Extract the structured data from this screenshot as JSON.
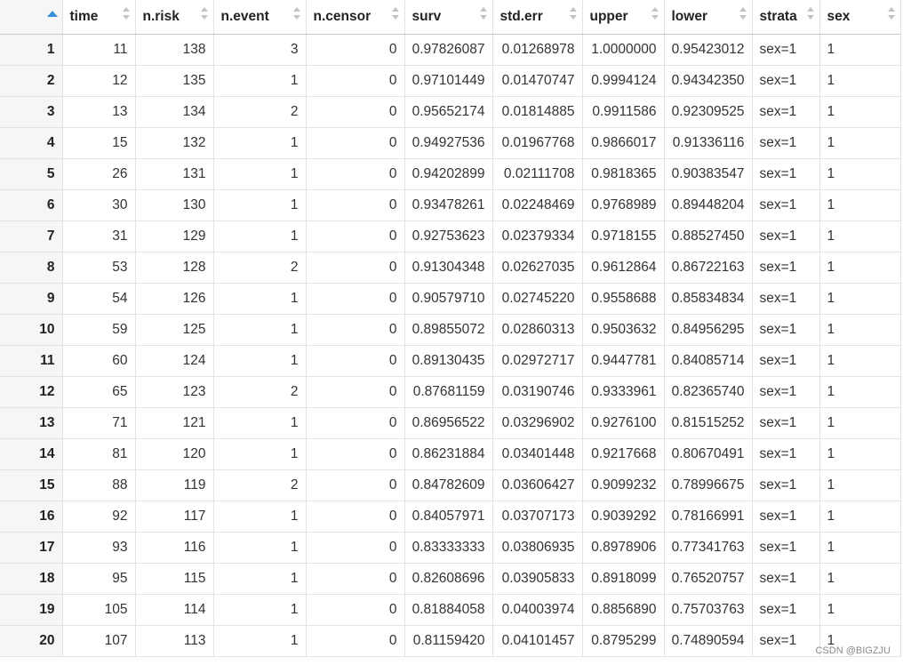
{
  "columns": [
    "",
    "time",
    "n.risk",
    "n.event",
    "n.censor",
    "surv",
    "std.err",
    "upper",
    "lower",
    "strata",
    "sex"
  ],
  "rows": [
    [
      "1",
      "11",
      "138",
      "3",
      "0",
      "0.97826087",
      "0.01268978",
      "1.0000000",
      "0.95423012",
      "sex=1",
      "1"
    ],
    [
      "2",
      "12",
      "135",
      "1",
      "0",
      "0.97101449",
      "0.01470747",
      "0.9994124",
      "0.94342350",
      "sex=1",
      "1"
    ],
    [
      "3",
      "13",
      "134",
      "2",
      "0",
      "0.95652174",
      "0.01814885",
      "0.9911586",
      "0.92309525",
      "sex=1",
      "1"
    ],
    [
      "4",
      "15",
      "132",
      "1",
      "0",
      "0.94927536",
      "0.01967768",
      "0.9866017",
      "0.91336116",
      "sex=1",
      "1"
    ],
    [
      "5",
      "26",
      "131",
      "1",
      "0",
      "0.94202899",
      "0.02111708",
      "0.9818365",
      "0.90383547",
      "sex=1",
      "1"
    ],
    [
      "6",
      "30",
      "130",
      "1",
      "0",
      "0.93478261",
      "0.02248469",
      "0.9768989",
      "0.89448204",
      "sex=1",
      "1"
    ],
    [
      "7",
      "31",
      "129",
      "1",
      "0",
      "0.92753623",
      "0.02379334",
      "0.9718155",
      "0.88527450",
      "sex=1",
      "1"
    ],
    [
      "8",
      "53",
      "128",
      "2",
      "0",
      "0.91304348",
      "0.02627035",
      "0.9612864",
      "0.86722163",
      "sex=1",
      "1"
    ],
    [
      "9",
      "54",
      "126",
      "1",
      "0",
      "0.90579710",
      "0.02745220",
      "0.9558688",
      "0.85834834",
      "sex=1",
      "1"
    ],
    [
      "10",
      "59",
      "125",
      "1",
      "0",
      "0.89855072",
      "0.02860313",
      "0.9503632",
      "0.84956295",
      "sex=1",
      "1"
    ],
    [
      "11",
      "60",
      "124",
      "1",
      "0",
      "0.89130435",
      "0.02972717",
      "0.9447781",
      "0.84085714",
      "sex=1",
      "1"
    ],
    [
      "12",
      "65",
      "123",
      "2",
      "0",
      "0.87681159",
      "0.03190746",
      "0.9333961",
      "0.82365740",
      "sex=1",
      "1"
    ],
    [
      "13",
      "71",
      "121",
      "1",
      "0",
      "0.86956522",
      "0.03296902",
      "0.9276100",
      "0.81515252",
      "sex=1",
      "1"
    ],
    [
      "14",
      "81",
      "120",
      "1",
      "0",
      "0.86231884",
      "0.03401448",
      "0.9217668",
      "0.80670491",
      "sex=1",
      "1"
    ],
    [
      "15",
      "88",
      "119",
      "2",
      "0",
      "0.84782609",
      "0.03606427",
      "0.9099232",
      "0.78996675",
      "sex=1",
      "1"
    ],
    [
      "16",
      "92",
      "117",
      "1",
      "0",
      "0.84057971",
      "0.03707173",
      "0.9039292",
      "0.78166991",
      "sex=1",
      "1"
    ],
    [
      "17",
      "93",
      "116",
      "1",
      "0",
      "0.83333333",
      "0.03806935",
      "0.8978906",
      "0.77341763",
      "sex=1",
      "1"
    ],
    [
      "18",
      "95",
      "115",
      "1",
      "0",
      "0.82608696",
      "0.03905833",
      "0.8918099",
      "0.76520757",
      "sex=1",
      "1"
    ],
    [
      "19",
      "105",
      "114",
      "1",
      "0",
      "0.81884058",
      "0.04003974",
      "0.8856890",
      "0.75703763",
      "sex=1",
      "1"
    ],
    [
      "20",
      "107",
      "113",
      "1",
      "0",
      "0.81159420",
      "0.04101457",
      "0.8795299",
      "0.74890594",
      "sex=1",
      "1"
    ]
  ],
  "watermark": "CSDN @BIGZJU",
  "sort_indicator_color": "#3b8fd9"
}
